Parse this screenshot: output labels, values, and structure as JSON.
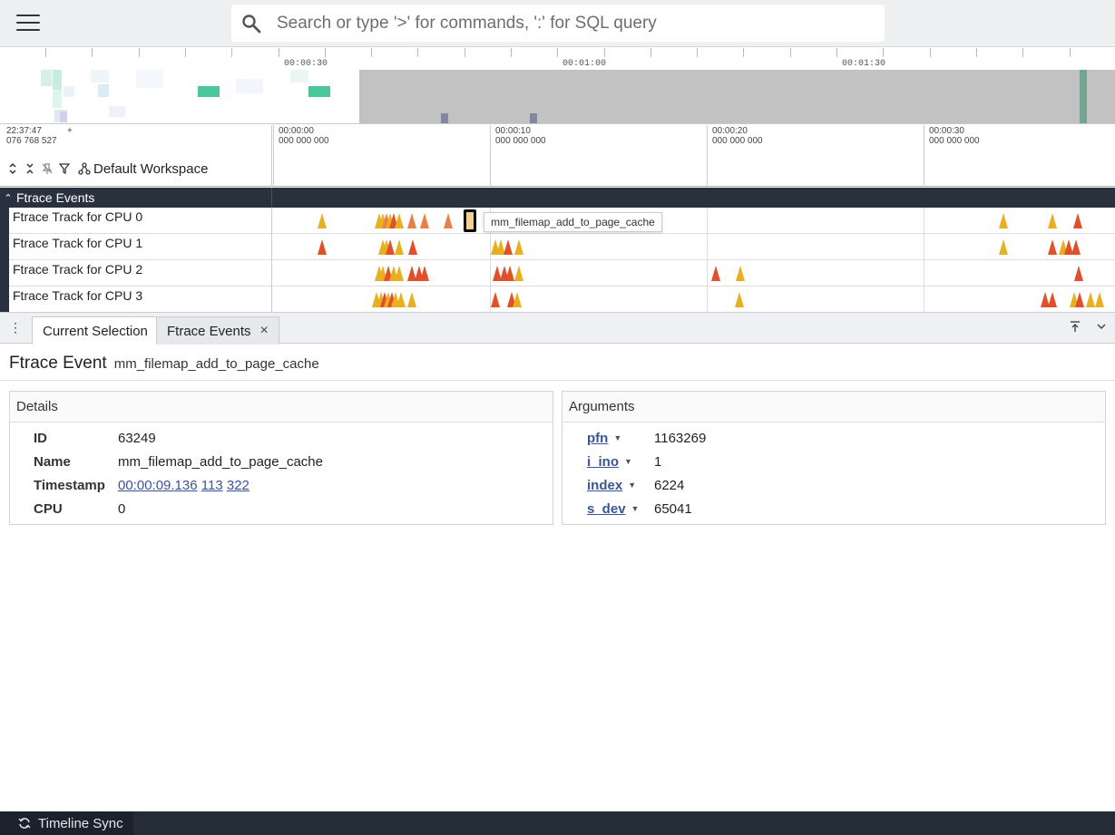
{
  "search": {
    "placeholder": "Search or type '>' for commands, ':' for SQL query"
  },
  "overview": {
    "labels": [
      "00:00:30",
      "00:01:00",
      "00:01:30"
    ]
  },
  "header": {
    "origin_time": "22:37:47",
    "origin_ns": "076 768 527",
    "origin_plus": "+",
    "workspace": "Default Workspace",
    "axis": [
      {
        "time": "00:00:00",
        "ns": "000 000 000"
      },
      {
        "time": "00:00:10",
        "ns": "000 000 000"
      },
      {
        "time": "00:00:20",
        "ns": "000 000 000"
      },
      {
        "time": "00:00:30",
        "ns": "000 000 000"
      }
    ]
  },
  "group": {
    "title": "Ftrace Events"
  },
  "tracks": [
    {
      "name": "Ftrace Track for CPU 0"
    },
    {
      "name": "Ftrace Track for CPU 1"
    },
    {
      "name": "Ftrace Track for CPU 2"
    },
    {
      "name": "Ftrace Track for CPU 3"
    }
  ],
  "tooltip": "mm_filemap_add_to_page_cache",
  "tabs": {
    "current": "Current Selection",
    "ftrace": "Ftrace Events",
    "close": "×"
  },
  "selection": {
    "kind": "Ftrace Event",
    "name": "mm_filemap_add_to_page_cache",
    "details": {
      "title": "Details",
      "rows": [
        {
          "key": "ID",
          "value": "63249"
        },
        {
          "key": "Name",
          "value": "mm_filemap_add_to_page_cache"
        },
        {
          "key": "Timestamp",
          "value": ""
        },
        {
          "key": "CPU",
          "value": "0"
        }
      ],
      "timestamp_parts": [
        "00:00:09.136",
        "113",
        "322"
      ]
    },
    "arguments": {
      "title": "Arguments",
      "rows": [
        {
          "key": "pfn",
          "value": "1163269"
        },
        {
          "key": "i_ino",
          "value": "1"
        },
        {
          "key": "index",
          "value": "6224"
        },
        {
          "key": "s_dev",
          "value": "65041"
        }
      ]
    }
  },
  "status": {
    "sync": "Timeline Sync"
  },
  "colors": {
    "accent": "#3a5596",
    "group": "#29313f",
    "event_yellow": "#e8b020",
    "event_red": "#e0502a"
  }
}
